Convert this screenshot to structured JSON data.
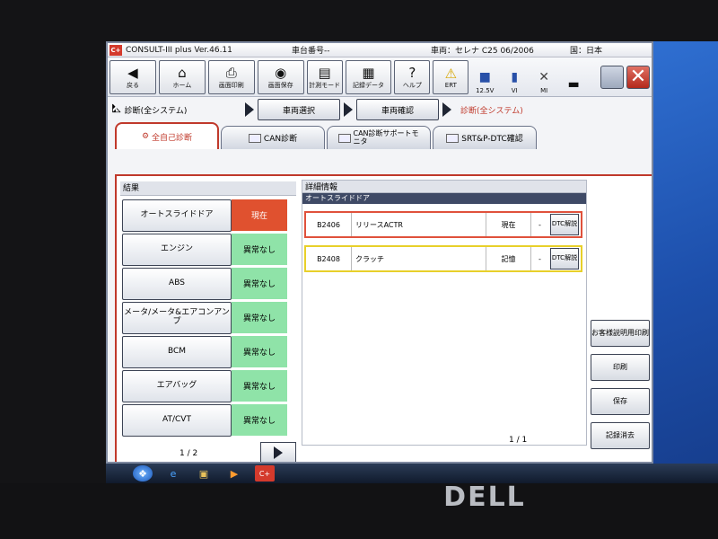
{
  "titlebar": {
    "app_badge": "C+",
    "app_title": "CONSULT-III plus Ver.46.11",
    "vehicle_no_label": "車台番号--",
    "vehicle_label": "車両：セレナ C25 06/2006",
    "country_label": "国：日本"
  },
  "toolbar": {
    "back_label": "戻る",
    "home_label": "ホーム",
    "print_screen_label": "画面印刷",
    "save_screen_label": "画面保存",
    "measure_mode_label": "計測モード",
    "record_data_label": "記録データ",
    "help_label": "ヘルプ",
    "ert_label": "ERT",
    "voltage_label": "12.5V",
    "vi_label": "VI",
    "mi_label": "MI"
  },
  "breadcrumb": {
    "title": "診断(全システム)",
    "step1": "車両選択",
    "step2": "車両確認",
    "current": "診断(全システム)"
  },
  "tabs": [
    {
      "label": "全自己診断"
    },
    {
      "label": "CAN診断"
    },
    {
      "label": "CAN診断サポートモニタ"
    },
    {
      "label": "SRT&P-DTC確認"
    }
  ],
  "results": {
    "header": "結果",
    "rows": [
      {
        "name": "オートスライドドア",
        "status": "現在",
        "color": "#e0512f"
      },
      {
        "name": "エンジン",
        "status": "異常なし",
        "color": "#8fe3a8"
      },
      {
        "name": "ABS",
        "status": "異常なし",
        "color": "#8fe3a8"
      },
      {
        "name": "メータ/メータ&エアコンアンプ",
        "status": "異常なし",
        "color": "#8fe3a8"
      },
      {
        "name": "BCM",
        "status": "異常なし",
        "color": "#8fe3a8"
      },
      {
        "name": "エアバッグ",
        "status": "異常なし",
        "color": "#8fe3a8"
      },
      {
        "name": "AT/CVT",
        "status": "異常なし",
        "color": "#8fe3a8"
      }
    ],
    "page": "1 / 2"
  },
  "detail": {
    "header": "詳細情報",
    "system": "オートスライドドア",
    "dtcs": [
      {
        "code": "B2406",
        "desc": "リリースACTR",
        "state": "現在",
        "dash": "-",
        "button": "DTC解説"
      },
      {
        "code": "B2408",
        "desc": "クラッチ",
        "state": "記憶",
        "dash": "-",
        "button": "DTC解説"
      }
    ],
    "page": "1 / 1"
  },
  "side_buttons": {
    "customer_print": "お客様説明用印刷",
    "print": "印刷",
    "save": "保存",
    "erase": "記録消去"
  },
  "brand": "DELL"
}
